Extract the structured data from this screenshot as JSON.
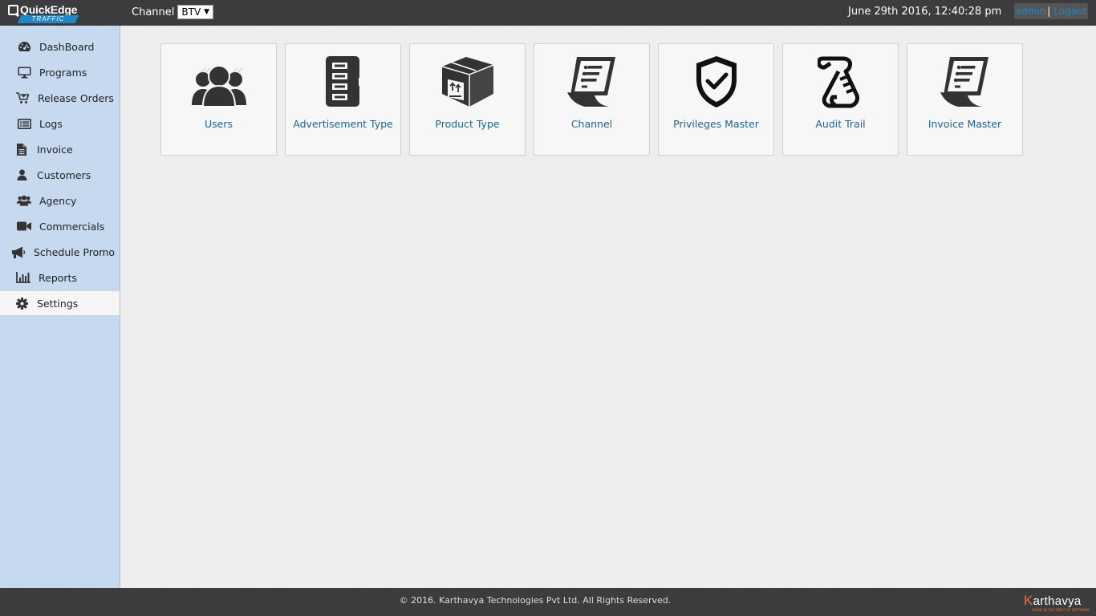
{
  "header": {
    "logo": {
      "name": "QuickEdge",
      "sub": "TRAFFIC"
    },
    "channel_label": "Channel",
    "channel_value": "BTV",
    "datetime": "June 29th 2016, 12:40:28 pm",
    "user": "admin",
    "separator": "|",
    "logout": "Logout"
  },
  "sidebar": {
    "items": [
      {
        "label": "DashBoard",
        "icon": "dashboard-icon"
      },
      {
        "label": "Programs",
        "icon": "monitor-icon"
      },
      {
        "label": "Release Orders",
        "icon": "cart-icon"
      },
      {
        "label": "Logs",
        "icon": "list-icon"
      },
      {
        "label": "Invoice",
        "icon": "file-icon"
      },
      {
        "label": "Customers",
        "icon": "user-icon"
      },
      {
        "label": "Agency",
        "icon": "users-icon"
      },
      {
        "label": "Commercials",
        "icon": "video-camera-icon"
      },
      {
        "label": "Schedule Promo",
        "icon": "megaphone-icon"
      },
      {
        "label": "Reports",
        "icon": "bar-chart-icon"
      },
      {
        "label": "Settings",
        "icon": "gear-icon",
        "active": true
      }
    ]
  },
  "tiles": [
    {
      "label": "Users",
      "icon": "users-group-icon"
    },
    {
      "label": "Advertisement Type",
      "icon": "ad-type-icon"
    },
    {
      "label": "Product Type",
      "icon": "package-box-icon"
    },
    {
      "label": "Channel",
      "icon": "document-list-icon"
    },
    {
      "label": "Privileges Master",
      "icon": "shield-check-icon"
    },
    {
      "label": "Audit Trail",
      "icon": "scroll-icon"
    },
    {
      "label": "Invoice Master",
      "icon": "invoice-document-icon"
    }
  ],
  "footer": {
    "copyright": "© 2016. Karthavya Technologies Pvt Ltd. All Rights Reserved.",
    "brand_first": "K",
    "brand_rest": "arthavya",
    "brand_tag": "SHAPE IN THE SPIRIT OF SOFTWARE"
  },
  "colors": {
    "accent": "#1e88c9",
    "link": "#1a6496",
    "sidebar_bg": "#c6d9ef",
    "header_bg": "#3a3a3c",
    "brand_orange": "#e8732a"
  }
}
